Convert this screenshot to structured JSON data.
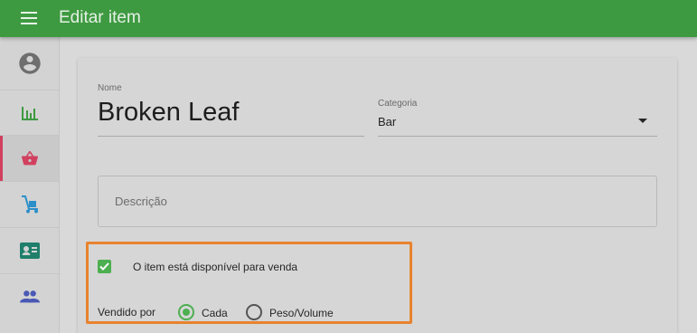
{
  "appbar": {
    "title": "Editar item",
    "color": "#3e9a41"
  },
  "sidebar": {
    "items": [
      {
        "icon": "account-circle-icon",
        "color": "#6e6e6e"
      },
      {
        "icon": "bar-chart-icon",
        "color": "#3e9a41"
      },
      {
        "icon": "shopping-basket-icon",
        "color": "#d1405f",
        "active": true
      },
      {
        "icon": "hand-truck-icon",
        "color": "#2b8fc9"
      },
      {
        "icon": "contact-card-icon",
        "color": "#1f7f6b"
      },
      {
        "icon": "people-icon",
        "color": "#4a59b5"
      }
    ]
  },
  "form": {
    "name_label": "Nome",
    "name_value": "Broken Leaf",
    "category_label": "Categoria",
    "category_value": "Bar",
    "description_placeholder": "Descrição",
    "available_label": "O item está disponível para venda",
    "available_checked": true,
    "sold_by_label": "Vendido por",
    "sold_by_options": [
      {
        "label": "Cada",
        "selected": true
      },
      {
        "label": "Peso/Volume",
        "selected": false
      }
    ]
  },
  "colors": {
    "accent": "#4caf50",
    "highlight": "#e8832e",
    "active_indicator": "#d1405f"
  }
}
